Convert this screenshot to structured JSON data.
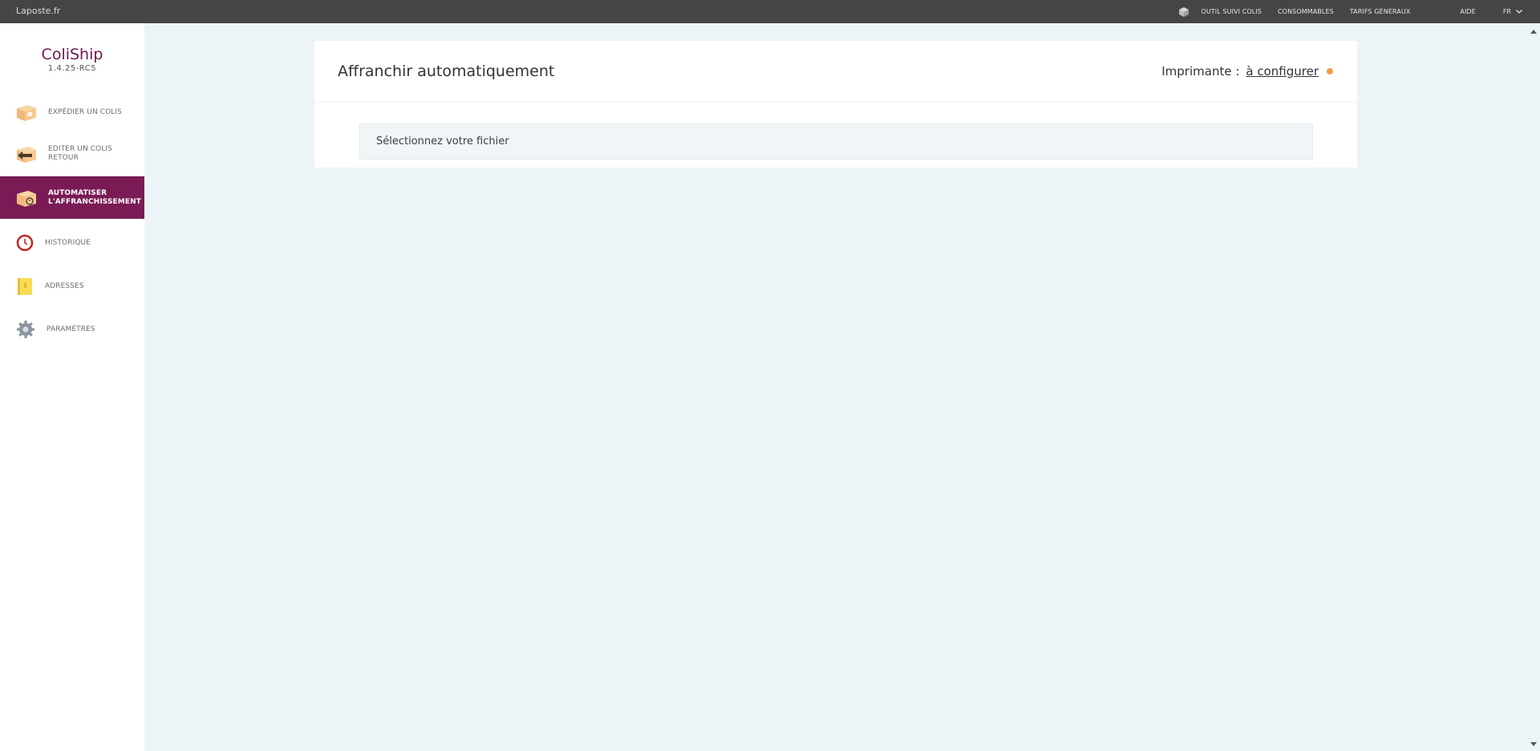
{
  "topbar": {
    "site_link": "Laposte.fr",
    "nav": [
      {
        "label": "OUTIL SUIVI COLIS"
      },
      {
        "label": "CONSOMMABLES"
      },
      {
        "label": "TARIFS GÉNÉRAUX"
      }
    ],
    "help": "AIDE",
    "language": "FR"
  },
  "sidebar": {
    "app_name": "ColiShip",
    "version": "1.4.25-RC5",
    "items": [
      {
        "label": "EXPÉDIER UN COLIS",
        "icon": "package-icon"
      },
      {
        "label": "EDITER UN COLIS RETOUR",
        "icon": "return-package-icon"
      },
      {
        "label": "AUTOMATISER L'AFFRANCHISSEMENT",
        "icon": "automate-package-icon",
        "active": true
      },
      {
        "label": "HISTORIQUE",
        "icon": "clock-icon"
      },
      {
        "label": "ADRESSES",
        "icon": "address-book-icon"
      },
      {
        "label": "PARAMÈTRES",
        "icon": "gear-icon"
      }
    ]
  },
  "main": {
    "title": "Affranchir automatiquement",
    "printer_label": "Imprimante :",
    "printer_link": "à configurer",
    "file_select_label": "Sélectionnez votre fichier"
  },
  "colors": {
    "brand": "#7a1b56",
    "topbar_bg": "#454545",
    "page_bg": "#ecf4f7",
    "status_dot": "#f0a040"
  }
}
